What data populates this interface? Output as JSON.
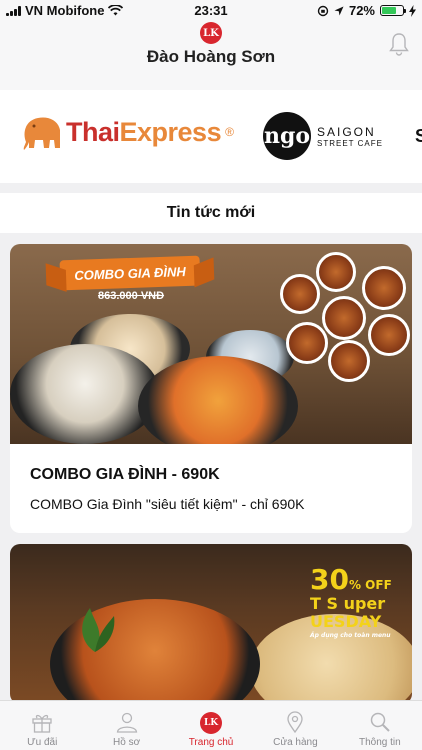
{
  "status_bar": {
    "carrier": "VN Mobifone",
    "time": "23:31",
    "battery_percent": "72%",
    "battery_level": 0.72
  },
  "header": {
    "logo_text": "LK",
    "title": "Đào Hoàng Sơn",
    "bell_icon": "bell-icon"
  },
  "brands": [
    {
      "name_part1": "Thai",
      "name_part2": "Express",
      "mark": "®"
    },
    {
      "logo_text": "ngo",
      "line1": "SAIGON",
      "line2": "STREET CAFE"
    },
    {
      "partial": "S"
    }
  ],
  "news": {
    "heading": "Tin tức mới",
    "items": [
      {
        "banner": "COMBO GIA ĐÌNH",
        "old_price": "863.000 VNĐ",
        "title": "COMBO GIA ĐÌNH - 690K",
        "description": "COMBO Gia Đình \"siêu tiết kiệm\" - chỉ 690K"
      },
      {
        "promo_main": "30",
        "promo_pct": "% OFF",
        "promo_sub": "T S uper",
        "promo_sub2": "UESDAY",
        "promo_note": "Áp dụng cho toàn menu"
      }
    ]
  },
  "tab_bar": {
    "tabs": [
      {
        "label": "Ưu đãi",
        "icon": "gift-icon"
      },
      {
        "label": "Hồ sơ",
        "icon": "profile-icon"
      },
      {
        "label": "Trang chủ",
        "icon": "home-logo-icon",
        "logo_text": "LK"
      },
      {
        "label": "Cửa hàng",
        "icon": "location-pin-icon"
      },
      {
        "label": "Thông tin",
        "icon": "search-icon"
      }
    ],
    "active_index": 2,
    "active_color": "#d8262e",
    "inactive_color": "#8a8a8e"
  }
}
